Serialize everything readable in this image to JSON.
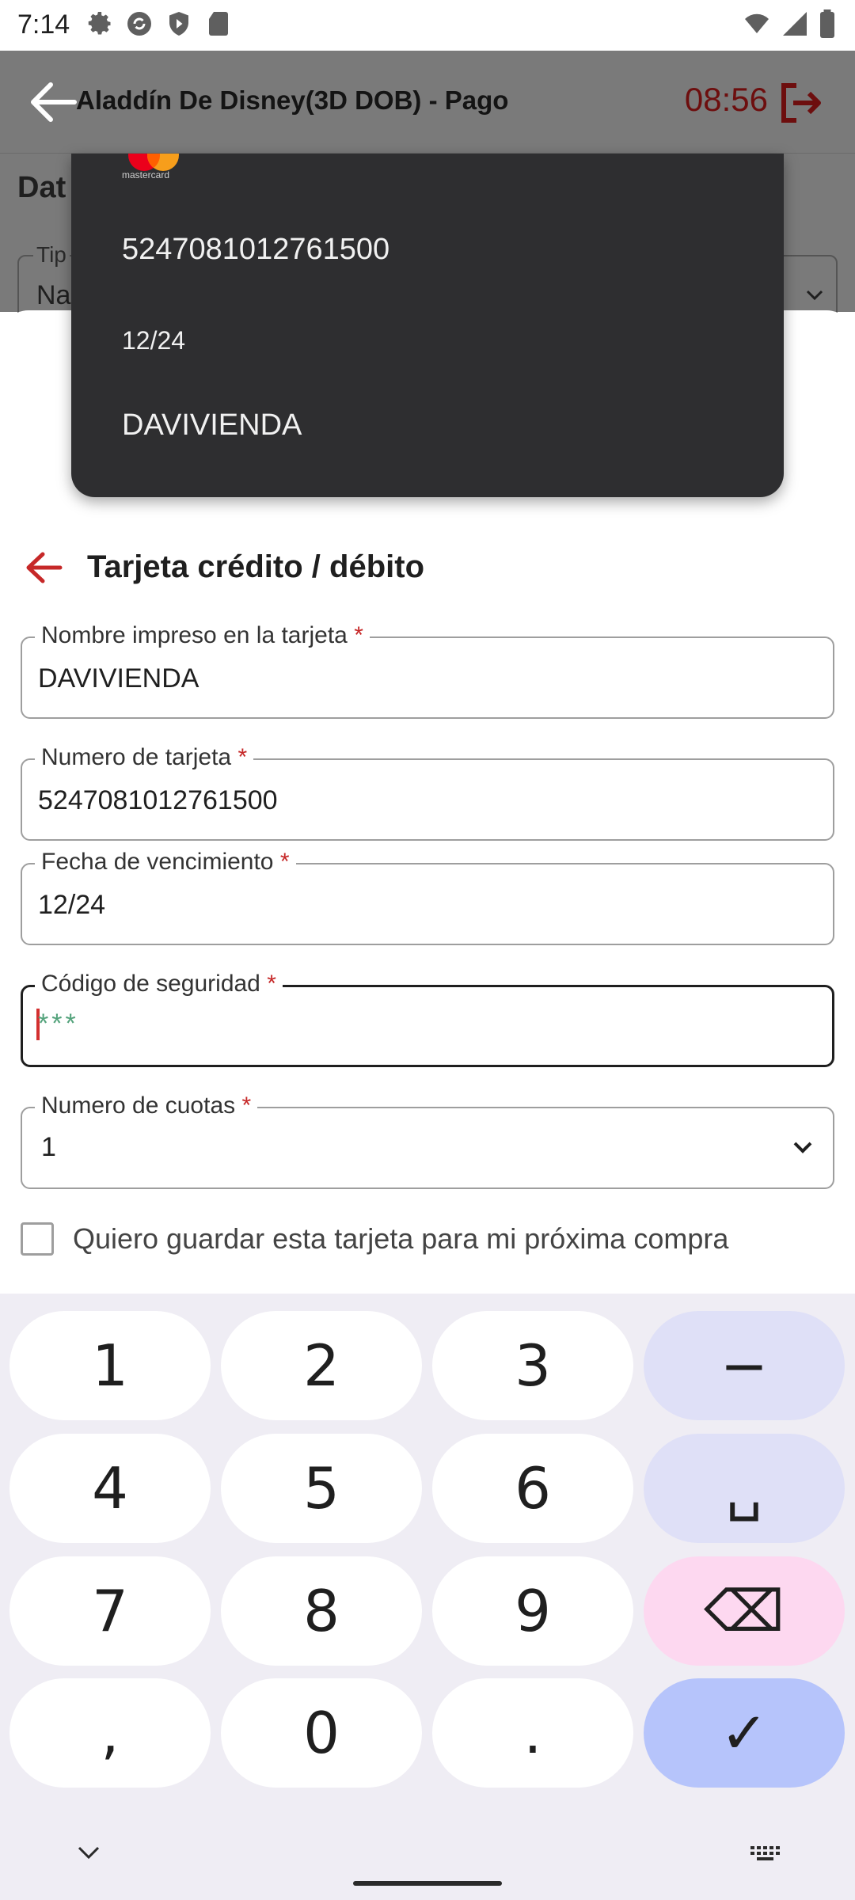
{
  "status_bar": {
    "time": "7:14",
    "icons": [
      "settings-icon",
      "sync-icon",
      "shield-play-icon",
      "sd-card-icon",
      "wifi-icon",
      "signal-icon",
      "battery-icon"
    ]
  },
  "app_bar": {
    "title": "Aladdín De Disney(3D DOB) - Pago",
    "timer": "08:56",
    "timer_color": "#6d0e0e"
  },
  "background_form": {
    "section_title_partial": "Dat",
    "field_label_partial": "Tip",
    "field_value_partial": "Na"
  },
  "autofill": {
    "brand_text": "mastercard",
    "card_number": "5247081012761500",
    "expiry": "12/24",
    "holder_name": "DAVIVIENDA"
  },
  "form": {
    "title": "Tarjeta crédito / débito",
    "required_mark": "*",
    "fields": {
      "name": {
        "label": "Nombre impreso en la tarjeta",
        "value": "DAVIVIENDA"
      },
      "number": {
        "label": "Numero de tarjeta",
        "value": "5247081012761500"
      },
      "expiry": {
        "label": "Fecha de vencimiento",
        "value": "12/24"
      },
      "cvv": {
        "label": "Código de seguridad",
        "placeholder": "***"
      },
      "installments": {
        "label": "Numero de cuotas",
        "value": "1"
      }
    },
    "save_card_label": "Quiero guardar esta tarjeta para mi próxima compra",
    "accent_color": "#c62828"
  },
  "keyboard": {
    "keys": [
      "1",
      "2",
      "3",
      "−",
      "4",
      "5",
      "6",
      "␣",
      "7",
      "8",
      "9",
      "⌫",
      ",",
      "0",
      ".",
      "✓"
    ]
  }
}
